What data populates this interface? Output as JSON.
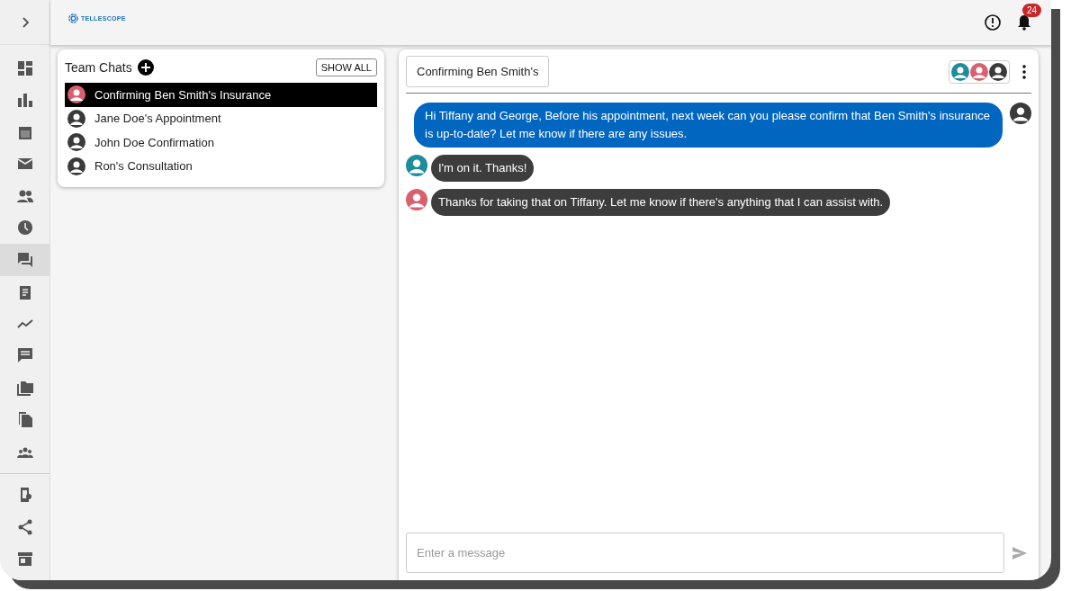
{
  "brand": {
    "name": "TELLESCOPE"
  },
  "notifications": {
    "count": "24"
  },
  "sidebar": {
    "items": [
      {
        "selected": false
      },
      {
        "selected": false
      },
      {
        "selected": false
      },
      {
        "selected": false
      },
      {
        "selected": false
      },
      {
        "selected": false
      },
      {
        "selected": true
      },
      {
        "selected": false
      },
      {
        "selected": false
      },
      {
        "selected": false
      },
      {
        "selected": false
      },
      {
        "selected": false
      },
      {
        "selected": false
      }
    ],
    "bottom_items": [
      {
        "selected": false
      },
      {
        "selected": false
      },
      {
        "selected": false
      }
    ]
  },
  "team_chats": {
    "title": "Team Chats",
    "show_all": "SHOW ALL",
    "items": [
      {
        "label": "Confirming Ben Smith's Insurance",
        "selected": true,
        "color": "#d9606e"
      },
      {
        "label": "Jane Doe's Appointment",
        "selected": false,
        "color": "#3a3a3a"
      },
      {
        "label": "John Doe Confirmation",
        "selected": false,
        "color": "#3a3a3a"
      },
      {
        "label": "Ron's Consultation",
        "selected": false,
        "color": "#3a3a3a"
      }
    ]
  },
  "chat": {
    "title": "Confirming Ben Smith's",
    "participants": [
      {
        "color": "#1e8c9a"
      },
      {
        "color": "#d9606e"
      },
      {
        "color": "#3a3a3a"
      }
    ],
    "messages": [
      {
        "kind": "outgoing",
        "text": "Hi Tiffany and George, Before his appointment, next week can you please confirm that Ben Smith's insurance is up-to-date? Let me know if there are any issues.",
        "color": "#3a3a3a"
      },
      {
        "kind": "incoming",
        "text": "I'm on it. Thanks!",
        "color": "#1e8c9a"
      },
      {
        "kind": "incoming",
        "text": "Thanks for taking that on Tiffany. Let me know if there's anything that I can assist with.",
        "color": "#d9606e"
      }
    ],
    "composer": {
      "placeholder": "Enter a message"
    }
  }
}
